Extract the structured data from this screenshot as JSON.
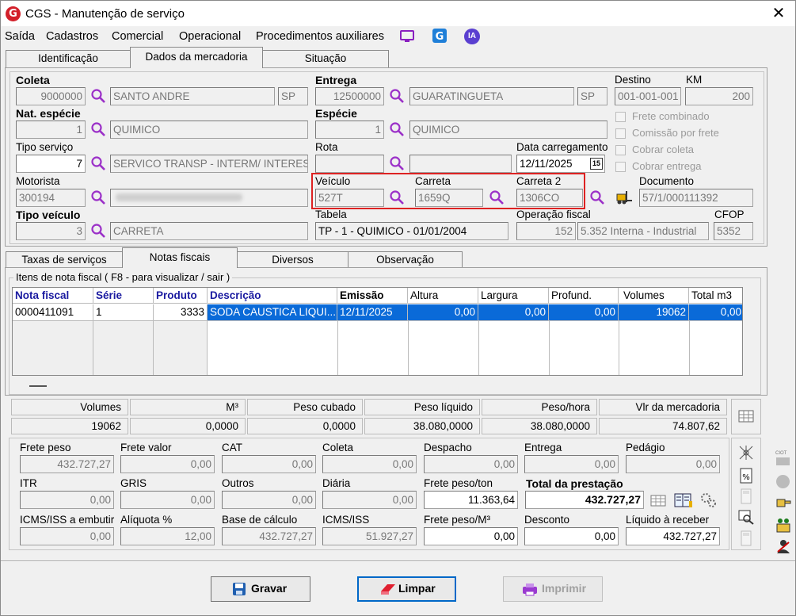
{
  "window": {
    "title": "CGS - Manutenção de serviço",
    "logo": "G"
  },
  "menu": [
    "Saída",
    "Cadastros",
    "Comercial",
    "Operacional",
    "Procedimentos auxiliares"
  ],
  "menu_icons": [
    "monitor-icon",
    "g-app-icon",
    "ia-icon"
  ],
  "ia_label": "IA",
  "tabs_top": [
    "Identificação",
    "Dados da mercadoria",
    "Situação"
  ],
  "coleta": {
    "label": "Coleta",
    "code": "9000000",
    "city": "SANTO ANDRE",
    "uf": "SP"
  },
  "entrega": {
    "label": "Entrega",
    "code": "12500000",
    "city": "GUARATINGUETA",
    "uf": "SP"
  },
  "destino": {
    "label": "Destino",
    "value": "001-001-001"
  },
  "km": {
    "label": "KM",
    "value": "200"
  },
  "nat_especie": {
    "label": "Nat. espécie",
    "code": "1",
    "name": "QUIMICO"
  },
  "especie": {
    "label": "Espécie",
    "code": "1",
    "name": "QUIMICO"
  },
  "tipo_servico": {
    "label": "Tipo serviço",
    "code": "7",
    "name": "SERVICO TRANSP - INTERM/ INTERES"
  },
  "rota": {
    "label": "Rota",
    "code": "",
    "name": ""
  },
  "data_carregamento": {
    "label": "Data carregamento",
    "value": "12/11/2025",
    "cal": "15"
  },
  "checks": [
    "Frete combinado",
    "Comissão por frete",
    "Cobrar coleta",
    "Cobrar entrega"
  ],
  "motorista": {
    "label": "Motorista",
    "code": "300194",
    "name": ""
  },
  "veiculo": {
    "label": "Veículo",
    "value": "527T"
  },
  "carreta": {
    "label": "Carreta",
    "value": "1659Q"
  },
  "carreta2": {
    "label": "Carreta 2",
    "value": "1306CO"
  },
  "documento": {
    "label": "Documento",
    "value": "57/1/000111392"
  },
  "tipo_veiculo": {
    "label": "Tipo veículo",
    "code": "3",
    "name": "CARRETA"
  },
  "tabela": {
    "label": "Tabela",
    "value": "TP - 1 - QUIMICO - 01/01/2004"
  },
  "operacao_fiscal": {
    "label": "Operação fiscal",
    "code": "152",
    "name": "5.352  Interna - Industrial"
  },
  "cfop": {
    "label": "CFOP",
    "value": "5352"
  },
  "tabs_mid": [
    "Taxas de serviços",
    "Notas fiscais",
    "Diversos",
    "Observação"
  ],
  "itens": {
    "legend": "Itens de nota fiscal ( F8 - para visualizar / sair )"
  },
  "grid": {
    "columns": [
      "Nota fiscal",
      "Série",
      "Produto",
      "Descrição",
      "Emissão",
      "Altura",
      "Largura",
      "Profund.",
      "Volumes",
      "Total m3"
    ],
    "rows": [
      [
        "0000411091",
        "1",
        "3333",
        "SODA CAUSTICA LIQUI...",
        "12/11/2025",
        "0,00",
        "0,00",
        "0,00",
        "19062",
        "0,00"
      ]
    ]
  },
  "totais": {
    "headers": [
      "Volumes",
      "M³",
      "Peso cubado",
      "Peso líquido",
      "Peso/hora",
      "Vlr da mercadoria"
    ],
    "values": [
      "19062",
      "0,0000",
      "0,0000",
      "38.080,0000",
      "38.080,0000",
      "74.807,62"
    ]
  },
  "calc": {
    "row1_labels": [
      "Frete peso",
      "Frete valor",
      "CAT",
      "Coleta",
      "Despacho",
      "Entrega",
      "Pedágio"
    ],
    "row1_values": [
      "432.727,27",
      "0,00",
      "0,00",
      "0,00",
      "0,00",
      "0,00",
      "0,00"
    ],
    "row2_labels": [
      "ITR",
      "GRIS",
      "Outros",
      "Diária",
      "Frete peso/ton",
      "Total da prestação"
    ],
    "row2_values": [
      "0,00",
      "0,00",
      "0,00",
      "0,00",
      "11.363,64",
      "432.727,27"
    ],
    "row3_labels": [
      "ICMS/ISS a embutir",
      "Alíquota %",
      "Base de cálculo",
      "ICMS/ISS",
      "Frete peso/M³",
      "Desconto",
      "Líquido à receber"
    ],
    "row3_values": [
      "0,00",
      "12,00",
      "432.727,27",
      "51.927,27",
      "0,00",
      "0,00",
      "432.727,27"
    ]
  },
  "buttons": {
    "gravar": "Gravar",
    "limpar": "Limpar",
    "imprimir": "Imprimir"
  },
  "side_label": "CIOT",
  "colors": {
    "selection": "#0a6ad8",
    "header_blue": "#1a1aa0",
    "accent_red": "#d22",
    "magnifier": "#9b30c8"
  }
}
